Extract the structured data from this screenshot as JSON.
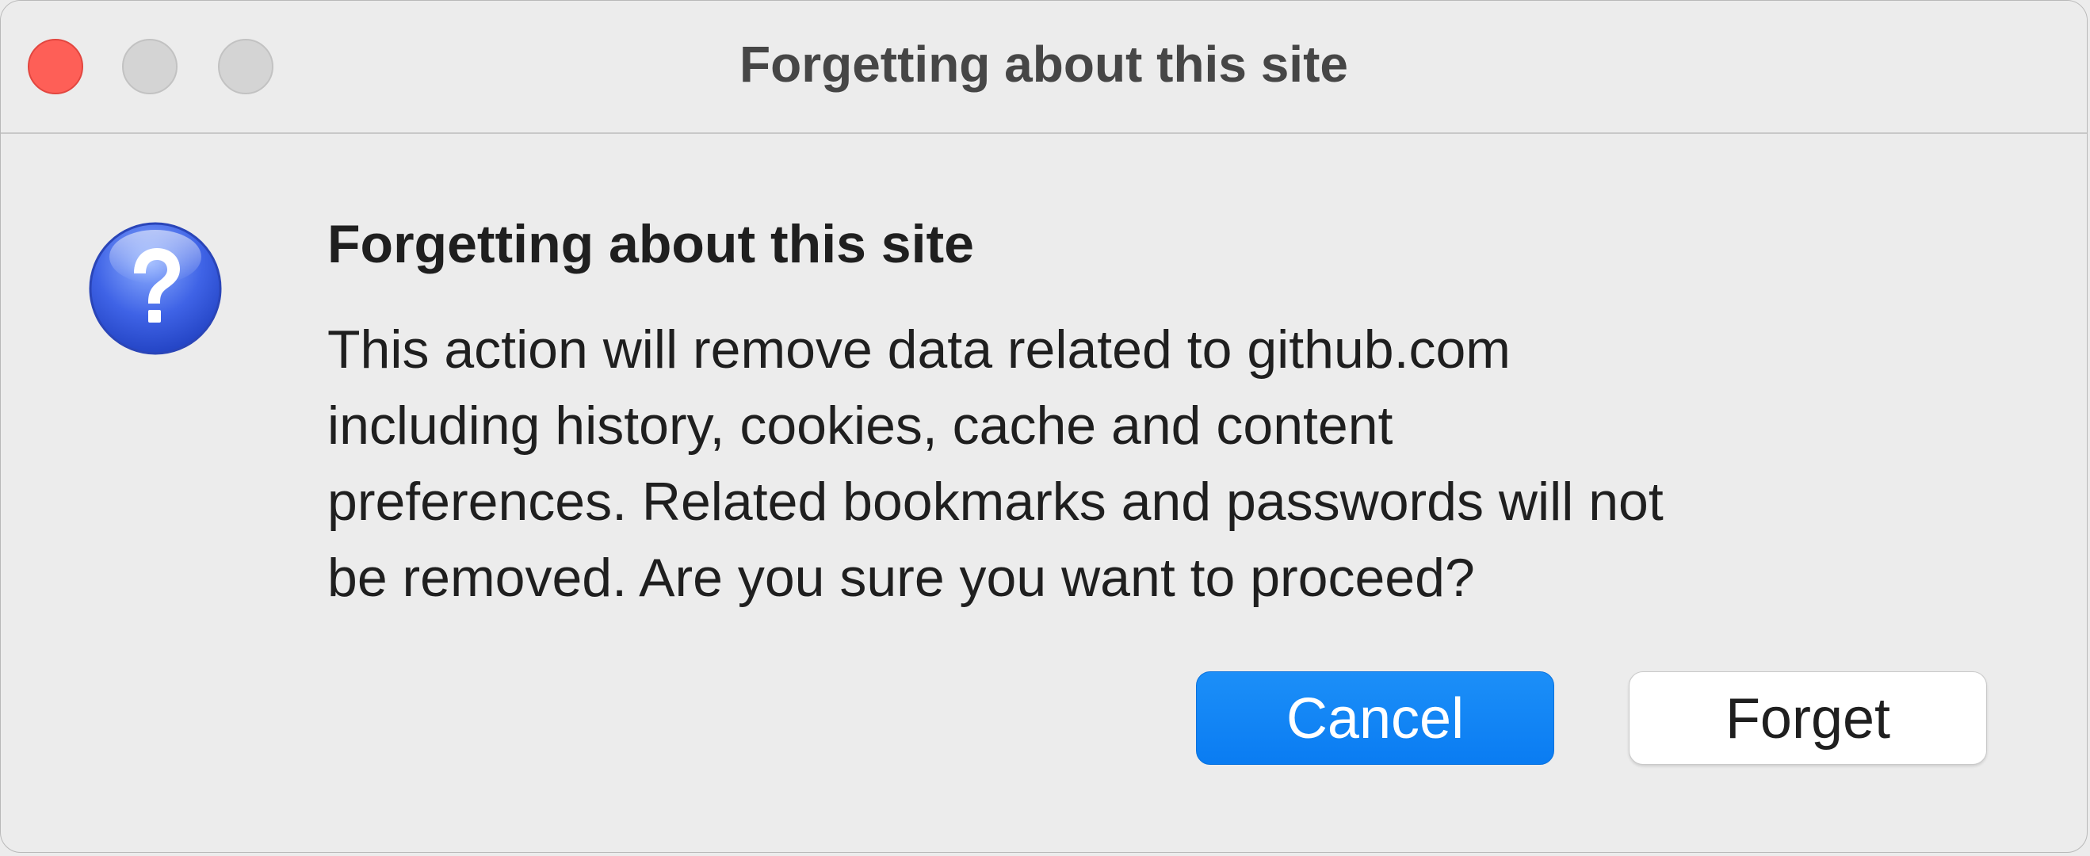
{
  "window": {
    "title": "Forgetting about this site"
  },
  "dialog": {
    "icon": "question-mark-icon",
    "heading": "Forgetting about this site",
    "message_lines": [
      "This action will remove data related to github.com",
      "including history, cookies, cache and content",
      "preferences. Related bookmarks and passwords will not",
      "be removed. Are you sure you want to proceed?"
    ],
    "cancel_label": "Cancel",
    "forget_label": "Forget"
  },
  "colors": {
    "accent_blue": "#0a7cf2",
    "close_red": "#fe5f57",
    "background": "#ececec"
  }
}
